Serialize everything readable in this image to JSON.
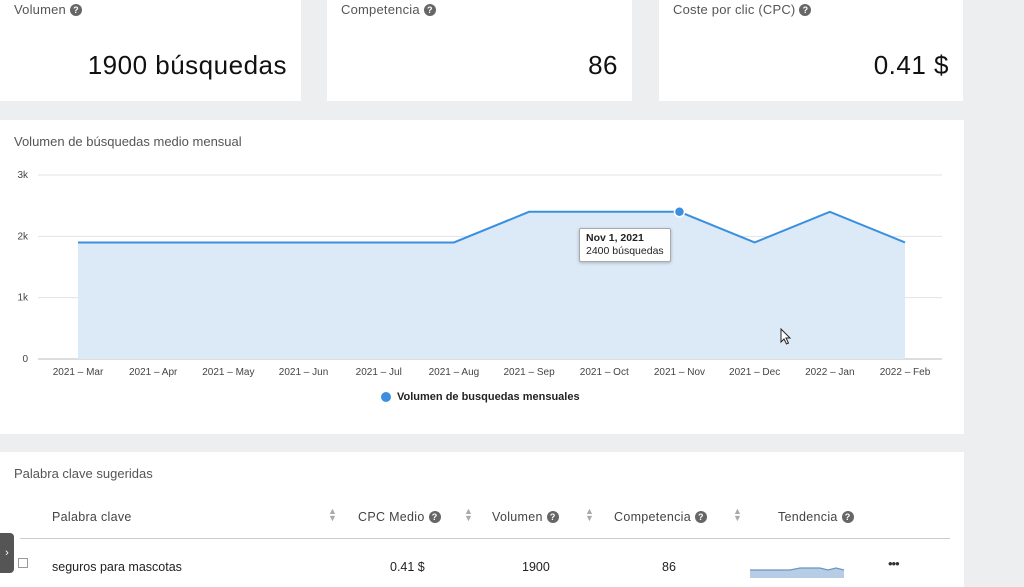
{
  "metrics": {
    "volume": {
      "label": "Volumen",
      "value": "1900 búsquedas"
    },
    "competition": {
      "label": "Competencia",
      "value": "86"
    },
    "cpc": {
      "label": "Coste por clic (CPC)",
      "value": "0.41 $"
    }
  },
  "chart": {
    "title": "Volumen de búsquedas medio mensual",
    "legend": "Volumen de busquedas mensuales",
    "tooltip": {
      "date": "Nov 1, 2021",
      "value": "2400 búsquedas"
    }
  },
  "chart_data": {
    "type": "area",
    "categories": [
      "2021 – Mar",
      "2021 – Apr",
      "2021 – May",
      "2021 – Jun",
      "2021 – Jul",
      "2021 – Aug",
      "2021 – Sep",
      "2021 – Oct",
      "2021 – Nov",
      "2021 – Dec",
      "2022 – Jan",
      "2022 – Feb"
    ],
    "series": [
      {
        "name": "Volumen de busquedas mensuales",
        "values": [
          1900,
          1900,
          1900,
          1900,
          1900,
          1900,
          2400,
          2400,
          2400,
          1900,
          2400,
          1900
        ]
      }
    ],
    "ylim": [
      0,
      3000
    ],
    "yticks": [
      0,
      1000,
      2000,
      3000
    ],
    "ytick_labels": [
      "0",
      "1k",
      "2k",
      "3k"
    ],
    "highlight_index": 8,
    "grid": true,
    "legend_position": "bottom-center",
    "color": "#3b8fe0",
    "fill": "#dceaf8"
  },
  "table": {
    "title": "Palabra clave sugeridas",
    "headers": {
      "keyword": "Palabra clave",
      "cpc": "CPC Medio",
      "volume": "Volumen",
      "competition": "Competencia",
      "trend": "Tendencia"
    },
    "rows": [
      {
        "keyword": "seguros para mascotas",
        "cpc": "0.41 $",
        "volume": "1900",
        "competition": "86",
        "more": "•••"
      }
    ]
  },
  "side_tab": {
    "glyph": "›"
  },
  "icons": {
    "help": "question-circle-icon",
    "sort": "sort-icon",
    "checkbox": "checkbox-icon",
    "more": "more-icon",
    "cursor": "mouse-cursor-icon"
  },
  "help_glyph": "?"
}
